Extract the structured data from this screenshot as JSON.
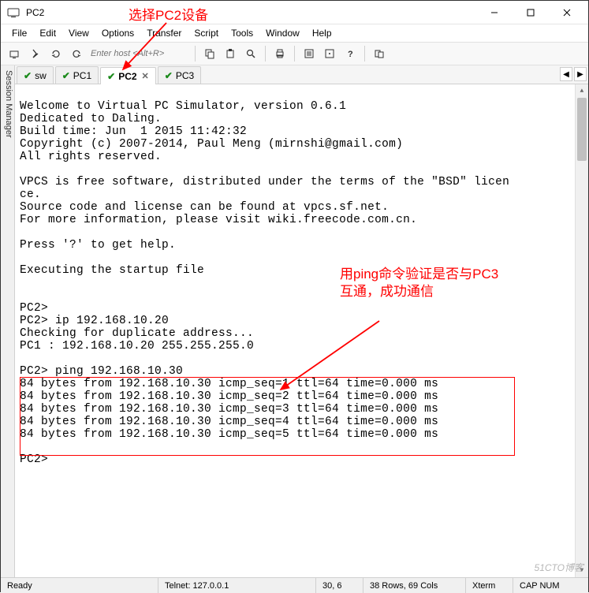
{
  "window": {
    "title": "PC2"
  },
  "menu": {
    "items": [
      "File",
      "Edit",
      "View",
      "Options",
      "Transfer",
      "Script",
      "Tools",
      "Window",
      "Help"
    ]
  },
  "toolbar": {
    "host_placeholder": "Enter host <Alt+R>"
  },
  "sidebar": {
    "label": "Session Manager"
  },
  "tabs": [
    {
      "label": "sw",
      "active": false
    },
    {
      "label": "PC1",
      "active": false
    },
    {
      "label": "PC2",
      "active": true
    },
    {
      "label": "PC3",
      "active": false
    }
  ],
  "terminal": {
    "lines": [
      "",
      "Welcome to Virtual PC Simulator, version 0.6.1",
      "Dedicated to Daling.",
      "Build time: Jun  1 2015 11:42:32",
      "Copyright (c) 2007-2014, Paul Meng (mirnshi@gmail.com)",
      "All rights reserved.",
      "",
      "VPCS is free software, distributed under the terms of the \"BSD\" licen",
      "ce.",
      "Source code and license can be found at vpcs.sf.net.",
      "For more information, please visit wiki.freecode.com.cn.",
      "",
      "Press '?' to get help.",
      "",
      "Executing the startup file",
      "",
      "",
      "PC2>",
      "PC2> ip 192.168.10.20",
      "Checking for duplicate address...",
      "PC1 : 192.168.10.20 255.255.255.0",
      "",
      "PC2> ping 192.168.10.30",
      "84 bytes from 192.168.10.30 icmp_seq=1 ttl=64 time=0.000 ms",
      "84 bytes from 192.168.10.30 icmp_seq=2 ttl=64 time=0.000 ms",
      "84 bytes from 192.168.10.30 icmp_seq=3 ttl=64 time=0.000 ms",
      "84 bytes from 192.168.10.30 icmp_seq=4 ttl=64 time=0.000 ms",
      "84 bytes from 192.168.10.30 icmp_seq=5 ttl=64 time=0.000 ms",
      "",
      "PC2>"
    ]
  },
  "status": {
    "ready": "Ready",
    "conn": "Telnet: 127.0.0.1",
    "pos": "30,  6",
    "size": "38 Rows, 69 Cols",
    "term": "Xterm",
    "caps": "CAP  NUM"
  },
  "annotations": {
    "top": "选择PC2设备",
    "right": "用ping命令验证是否与PC3互通，成功通信"
  },
  "watermark": "51CTO博客"
}
